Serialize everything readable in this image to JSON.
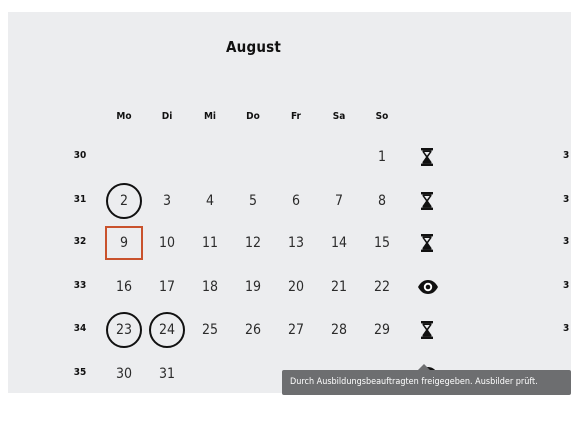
{
  "calendar": {
    "month": "August",
    "weekdays": [
      "Mo",
      "Di",
      "Mi",
      "Do",
      "Fr",
      "Sa",
      "So"
    ],
    "weeks": [
      {
        "number": "30",
        "days": [
          "",
          "",
          "",
          "",
          "",
          "",
          "1"
        ],
        "status_icon": "hourglass-icon",
        "edge": "3"
      },
      {
        "number": "31",
        "days": [
          "2",
          "3",
          "4",
          "5",
          "6",
          "7",
          "8"
        ],
        "status_icon": "hourglass-icon",
        "edge": "3"
      },
      {
        "number": "32",
        "days": [
          "9",
          "10",
          "11",
          "12",
          "13",
          "14",
          "15"
        ],
        "status_icon": "hourglass-icon",
        "edge": "3"
      },
      {
        "number": "33",
        "days": [
          "16",
          "17",
          "18",
          "19",
          "20",
          "21",
          "22"
        ],
        "status_icon": "eye-icon",
        "edge": "3"
      },
      {
        "number": "34",
        "days": [
          "23",
          "24",
          "25",
          "26",
          "27",
          "28",
          "29"
        ],
        "status_icon": "hourglass-icon",
        "edge": "3"
      },
      {
        "number": "35",
        "days": [
          "30",
          "31",
          "",
          "",
          "",
          "",
          ""
        ],
        "status_icon": "eye-icon",
        "edge": ""
      }
    ],
    "circled_days": [
      "2",
      "23",
      "24"
    ],
    "selected_day": "9"
  },
  "tooltip": {
    "text": "Durch Ausbildungsbeauftragten freigegeben. Ausbilder prüft."
  },
  "colors": {
    "panel_background": "#ecedef",
    "selected_border": "#c9522c",
    "circle_border": "#111111",
    "tooltip_background": "#6d6e70",
    "tooltip_text": "#ffffff"
  }
}
